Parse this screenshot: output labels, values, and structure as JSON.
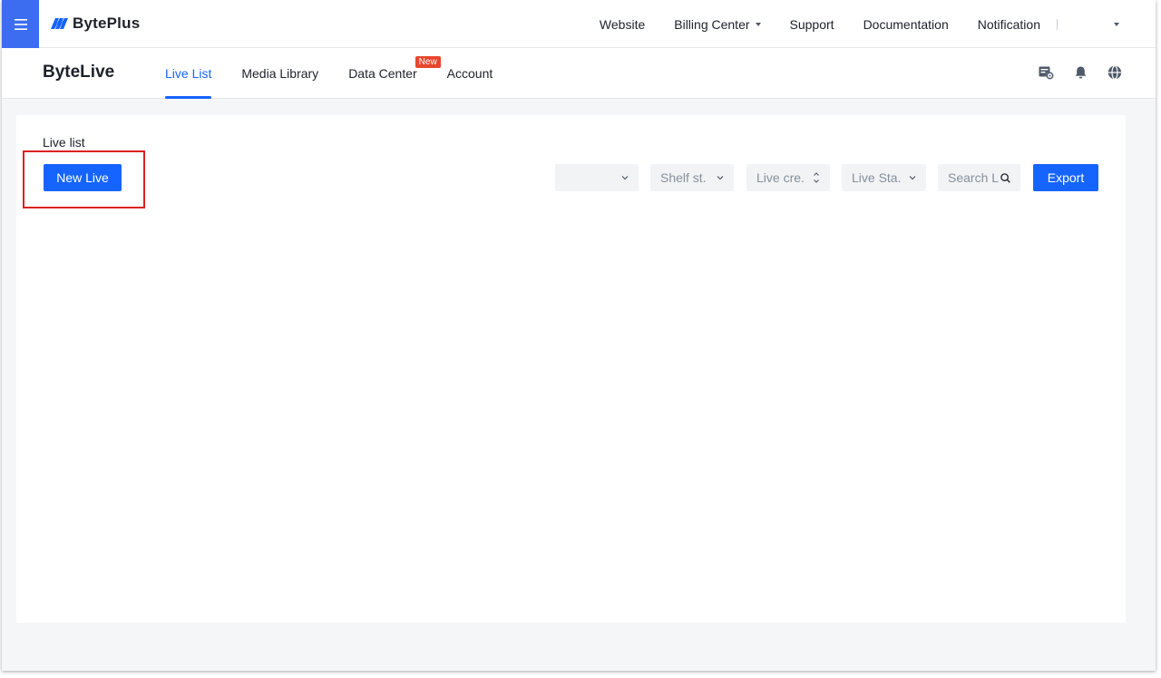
{
  "topnav": {
    "menu_icon": "hamburger-icon",
    "brand": "BytePlus",
    "brand_color": "#1664ff",
    "links": {
      "website": "Website",
      "billing": "Billing Center",
      "support": "Support",
      "documentation": "Documentation",
      "notification": "Notification"
    }
  },
  "product": {
    "title": "ByteLive",
    "tabs": {
      "live_list": "Live List",
      "media_library": "Media Library",
      "data_center": "Data Center",
      "data_center_badge": "New",
      "account": "Account"
    },
    "active_tab": "Live List",
    "icons": [
      "ticket-settings-icon",
      "bell-icon",
      "globe-icon"
    ]
  },
  "main": {
    "section_title": "Live list",
    "new_live_label": "New Live",
    "export_label": "Export",
    "filters": {
      "first": "",
      "shelf_status": "Shelf st.",
      "live_created": "Live cre.",
      "live_status": "Live Sta.",
      "search_placeholder": "Search L"
    },
    "accent_color": "#1664ff",
    "highlight_color": "#e02020"
  }
}
